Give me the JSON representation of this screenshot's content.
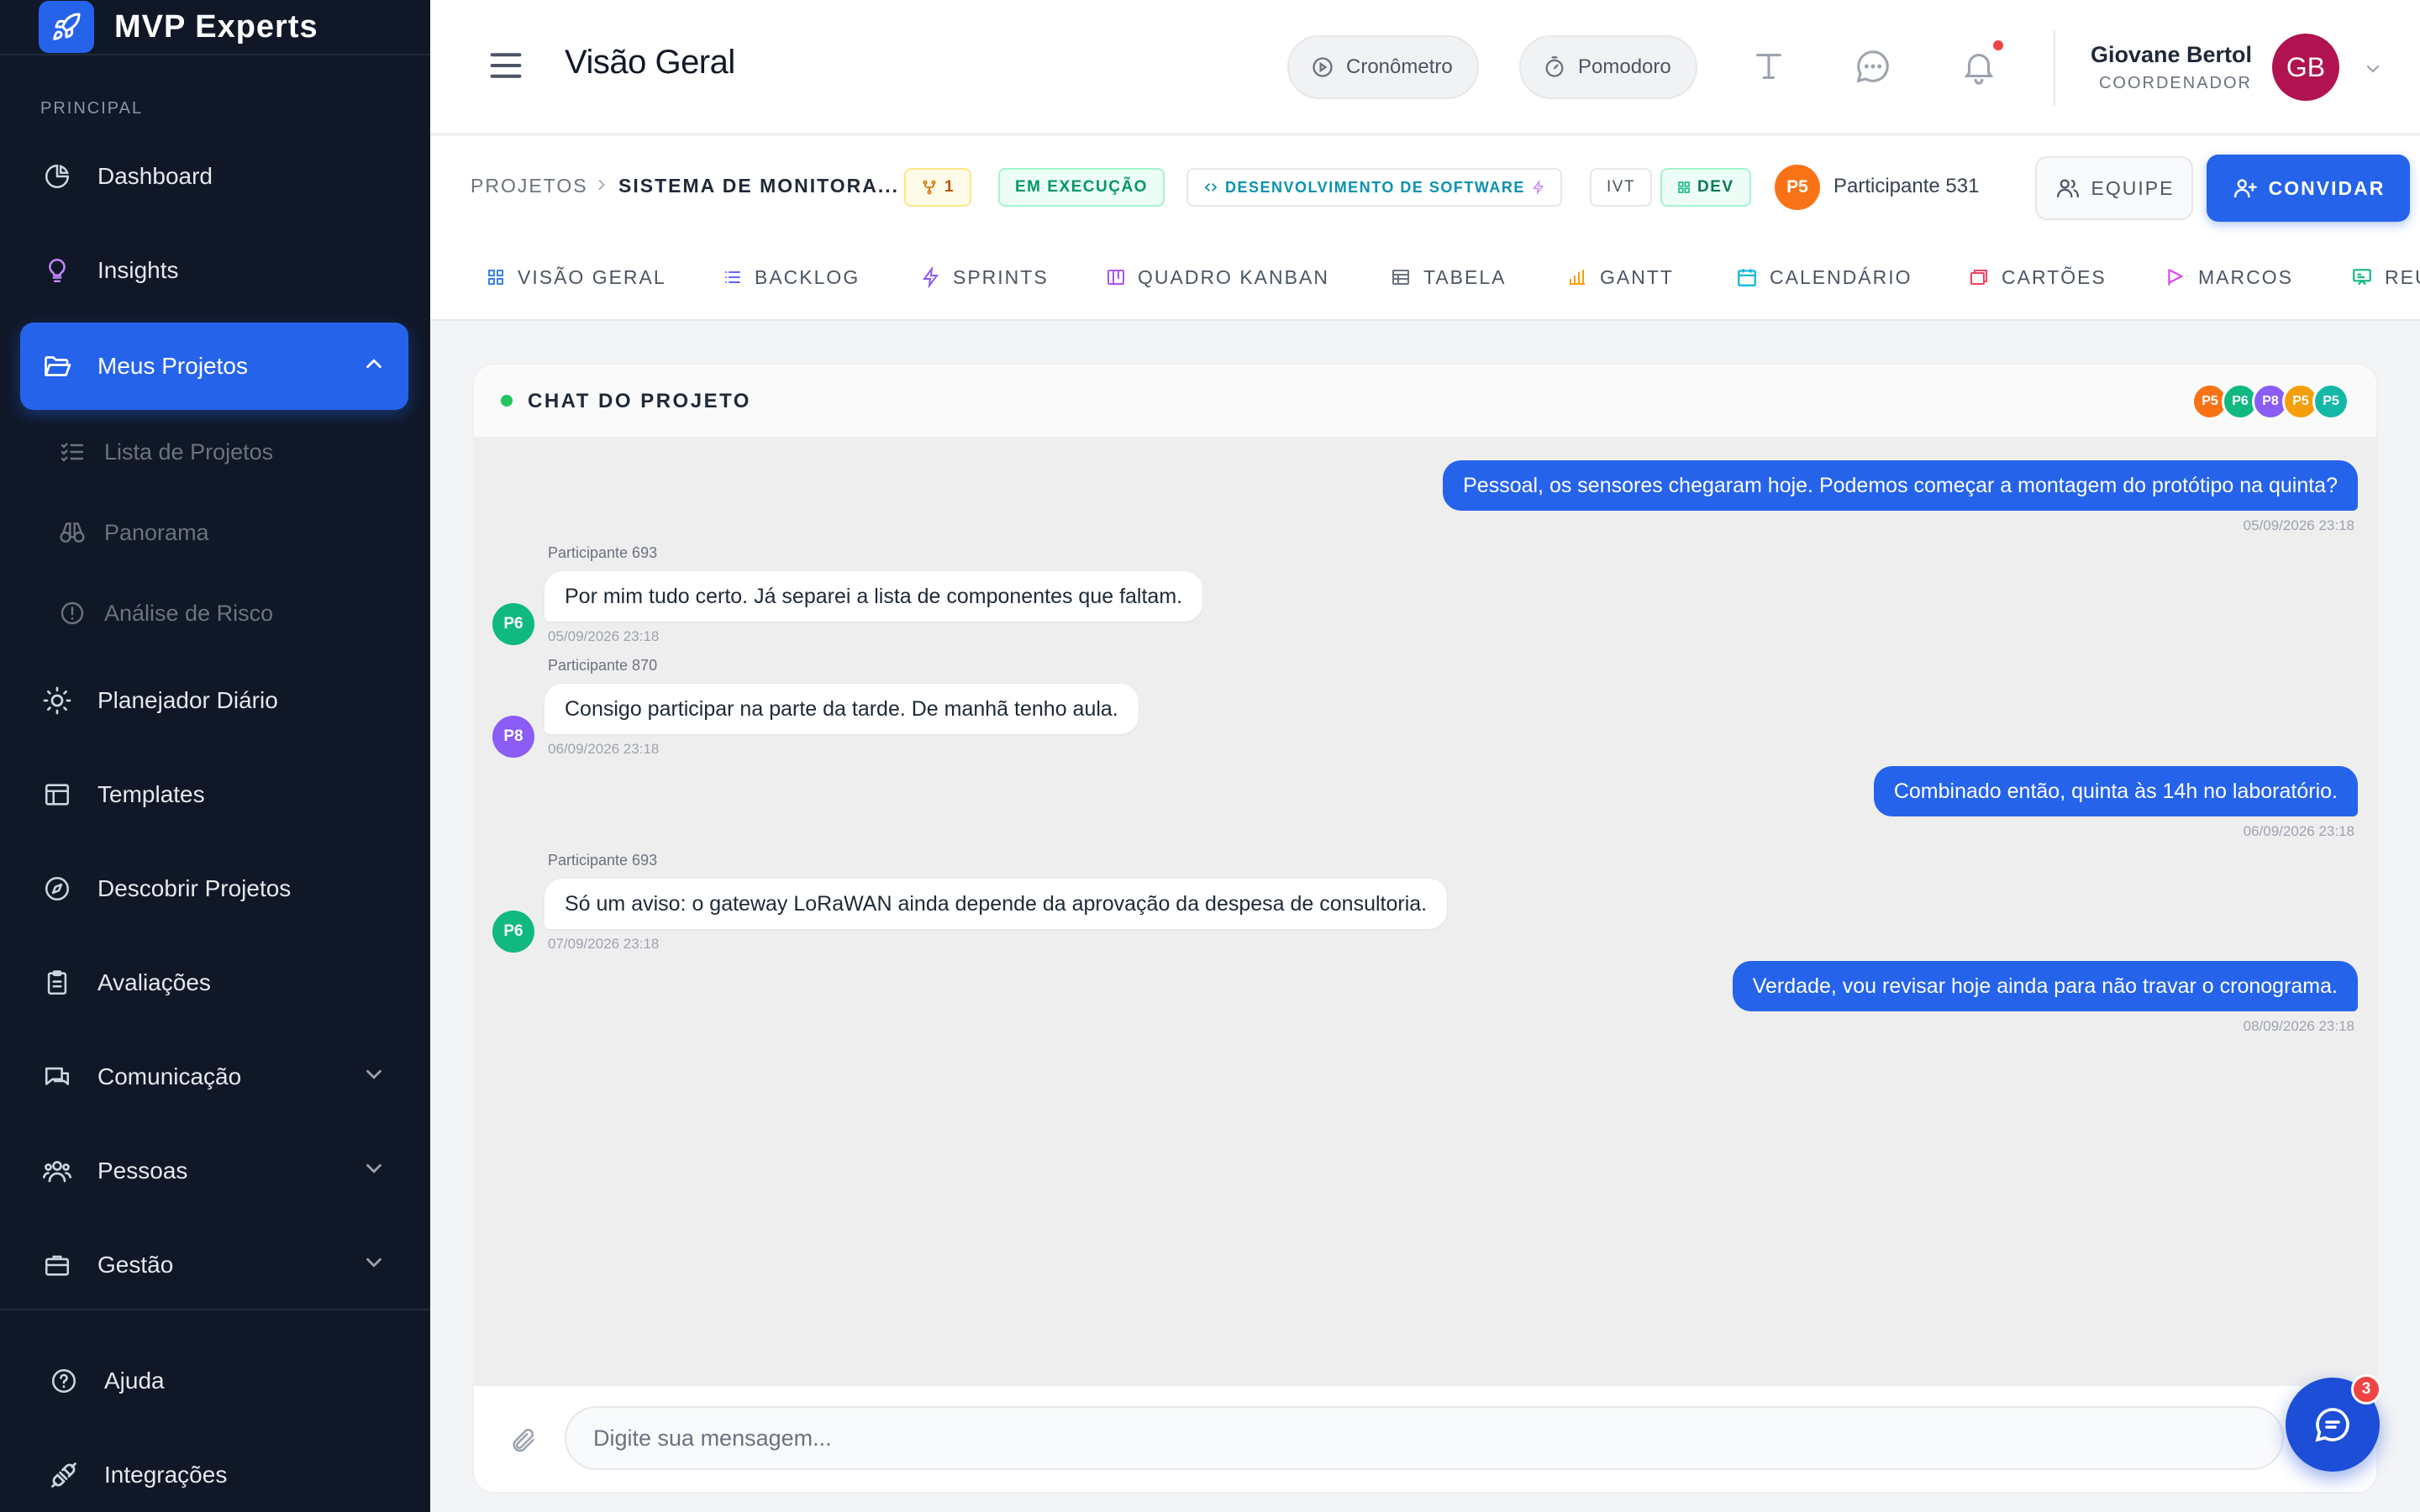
{
  "app": {
    "name": "MVP Experts"
  },
  "sidebar": {
    "section_label": "PRINCIPAL",
    "items": [
      {
        "label": "Dashboard"
      },
      {
        "label": "Insights"
      },
      {
        "label": "Meus Projetos"
      },
      {
        "label": "Planejador Diário"
      },
      {
        "label": "Templates"
      },
      {
        "label": "Descobrir Projetos"
      },
      {
        "label": "Avaliações"
      },
      {
        "label": "Comunicação"
      },
      {
        "label": "Pessoas"
      },
      {
        "label": "Gestão"
      }
    ],
    "subitems": [
      {
        "label": "Lista de Projetos"
      },
      {
        "label": "Panorama"
      },
      {
        "label": "Análise de Risco"
      }
    ],
    "footer": [
      {
        "label": "Ajuda"
      },
      {
        "label": "Integrações"
      }
    ]
  },
  "header": {
    "title": "Visão Geral",
    "cronometro": "Cronômetro",
    "pomodoro": "Pomodoro",
    "user_name": "Giovane Bertol",
    "user_role": "COORDENADOR",
    "user_initials": "GB"
  },
  "project": {
    "crumb_root": "PROJETOS",
    "crumb_current": "SISTEMA DE MONITORA...",
    "branch_count": "1",
    "status": "EM EXECUÇÃO",
    "category": "DESENVOLVIMENTO DE SOFTWARE",
    "tag_ivt": "IVT",
    "tag_dev": "DEV",
    "participant_initials": "P5",
    "participant_name": "Participante 531",
    "equipe_label": "EQUIPE",
    "convidar_label": "CONVIDAR"
  },
  "tabs": [
    {
      "label": "VISÃO GERAL"
    },
    {
      "label": "BACKLOG"
    },
    {
      "label": "SPRINTS"
    },
    {
      "label": "QUADRO KANBAN"
    },
    {
      "label": "TABELA"
    },
    {
      "label": "GANTT"
    },
    {
      "label": "CALENDÁRIO"
    },
    {
      "label": "CARTÕES"
    },
    {
      "label": "MARCOS"
    },
    {
      "label": "REU"
    }
  ],
  "chat": {
    "title": "CHAT DO PROJETO",
    "members": [
      {
        "initials": "P5",
        "color": "#f97316"
      },
      {
        "initials": "P6",
        "color": "#10b981"
      },
      {
        "initials": "P8",
        "color": "#8b5cf6"
      },
      {
        "initials": "P5",
        "color": "#f59e0b"
      },
      {
        "initials": "P5",
        "color": "#14b8a6"
      }
    ],
    "messages": [
      {
        "text": "Pessoal, os sensores chegaram hoje. Podemos começar a montagem do protótipo na quinta?",
        "time": "05/09/2026 23:18"
      },
      {
        "sender": "Participante 693",
        "initials": "P6",
        "text": "Por mim tudo certo. Já separei a lista de componentes que faltam.",
        "time": "05/09/2026 23:18"
      },
      {
        "sender": "Participante 870",
        "initials": "P8",
        "text": "Consigo participar na parte da tarde. De manhã tenho aula.",
        "time": "06/09/2026 23:18"
      },
      {
        "text": "Combinado então, quinta às 14h no laboratório.",
        "time": "06/09/2026 23:18"
      },
      {
        "sender": "Participante 693",
        "initials": "P6",
        "text": "Só um aviso: o gateway LoRaWAN ainda depende da aprovação da despesa de consultoria.",
        "time": "07/09/2026 23:18"
      },
      {
        "text": "Verdade, vou revisar hoje ainda para não travar o cronograma.",
        "time": "08/09/2026 23:18"
      }
    ],
    "input_placeholder": "Digite sua mensagem...",
    "fab_badge": "3"
  }
}
